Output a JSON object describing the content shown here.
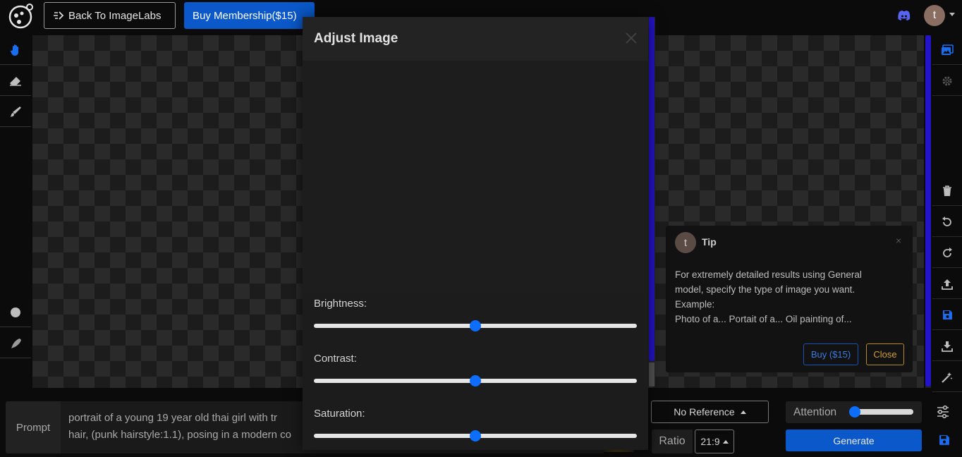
{
  "topbar": {
    "back_label": "Back To ImageLabs",
    "buy_label": "Buy Membership($15)",
    "avatar_initial": "t"
  },
  "left_tools": [
    "hand-icon",
    "eraser-icon",
    "brush-icon",
    "circle-icon",
    "pen-icon"
  ],
  "right_tools": [
    "gallery-icon",
    "settings-cog-icon",
    "trash-icon",
    "undo-icon",
    "redo-icon",
    "upload-icon",
    "save-icon",
    "download-icon",
    "magic-wand-icon"
  ],
  "tip": {
    "avatar_initial": "t",
    "title": "Tip",
    "lines": [
      "For extremely detailed results using General",
      "model, specify the type of image you want.",
      "Example:",
      "Photo of a... Portait of a... Oil painting of..."
    ],
    "buy_label": "Buy ($15)",
    "close_label": "Close"
  },
  "bottom": {
    "prompt_label": "Prompt",
    "prompt_lines": [
      "portrait of a young 19 year old thai girl with tr",
      "hair, (punk hairstyle:1.1), posing in a modern co"
    ],
    "reference_label": "No Reference",
    "ratio_label": "Ratio",
    "ratio_value": "21:9",
    "attention_label": "Attention",
    "attention_level": 0.0,
    "generate_label": "Generate"
  },
  "modal": {
    "title": "Adjust Image",
    "sliders": [
      {
        "label": "Brightness:",
        "value": 0.5
      },
      {
        "label": "Contrast:",
        "value": 0.5
      },
      {
        "label": "Saturation:",
        "value": 0.5
      }
    ]
  },
  "colors": {
    "accent_blue": "#0a58ca",
    "slider_blue": "#0d6efd",
    "scroll_indigo": "#2414c9",
    "close_gold": "#d0a030"
  }
}
